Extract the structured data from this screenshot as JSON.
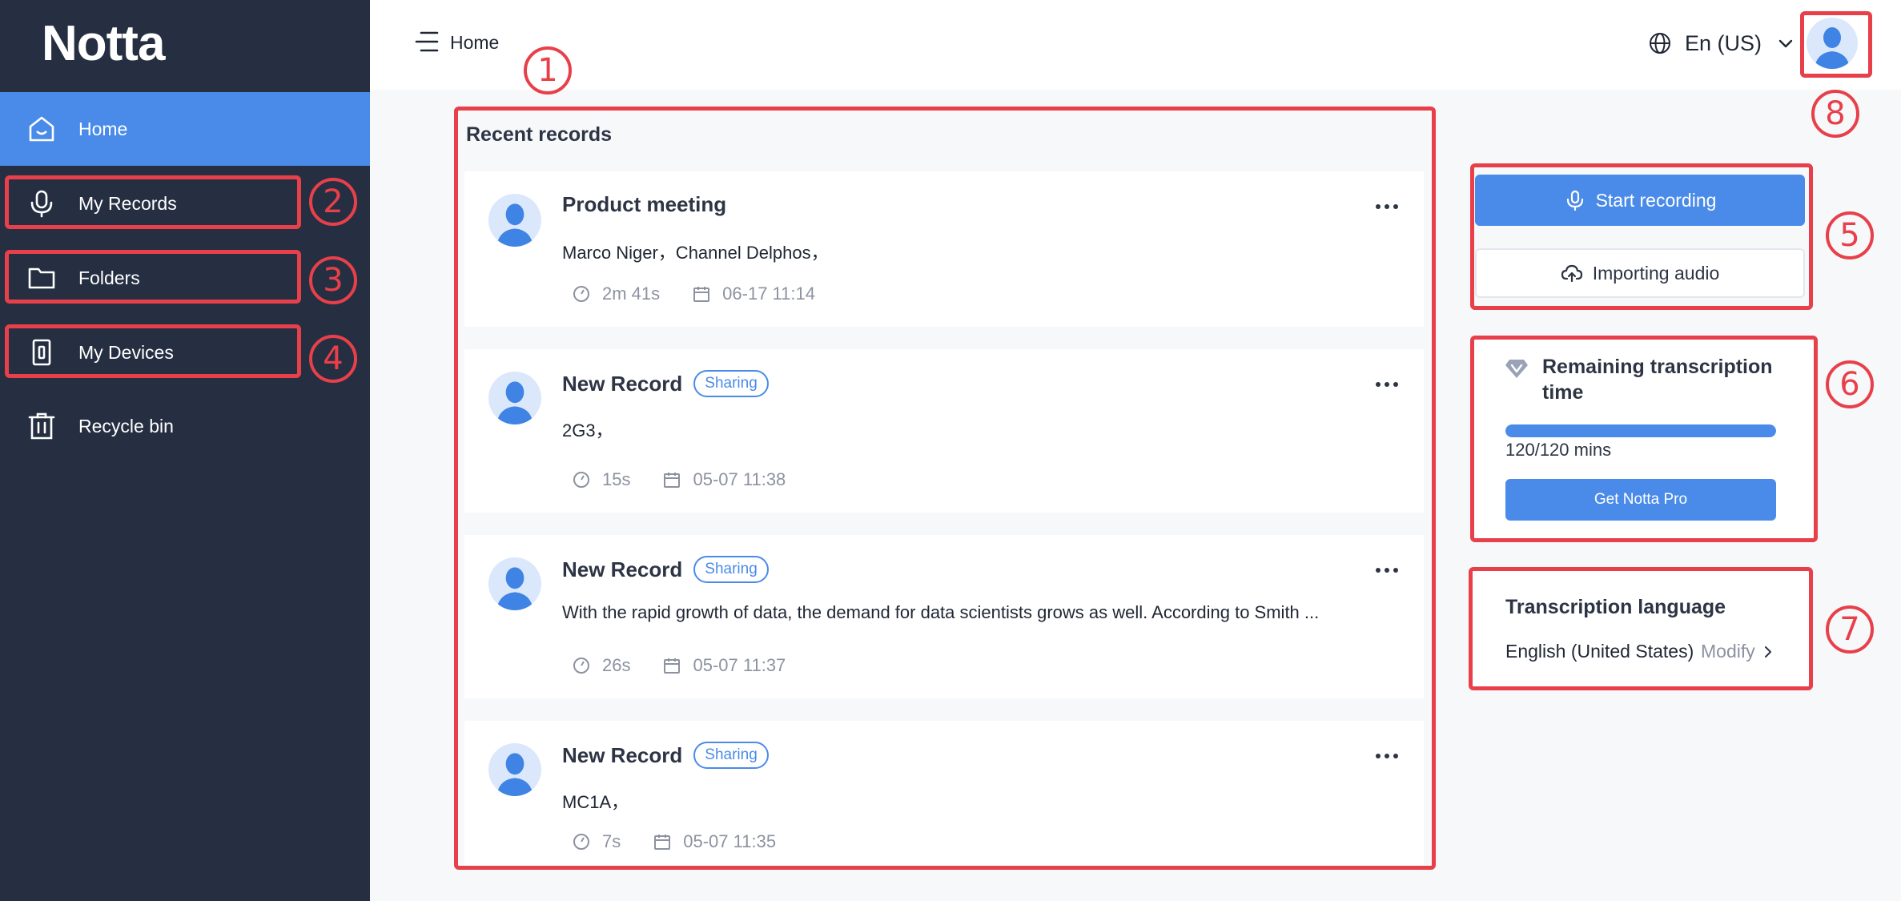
{
  "app": {
    "logo_text": "Notta"
  },
  "sidebar": {
    "items": [
      {
        "label": "Home",
        "icon": "home-icon",
        "active": true
      },
      {
        "label": "My Records",
        "icon": "microphone-icon",
        "active": false
      },
      {
        "label": "Folders",
        "icon": "folder-icon",
        "active": false
      },
      {
        "label": "My Devices",
        "icon": "device-icon",
        "active": false
      },
      {
        "label": "Recycle bin",
        "icon": "trash-icon",
        "active": false
      }
    ]
  },
  "header": {
    "breadcrumb": "Home",
    "language": "En (US)"
  },
  "records": {
    "title": "Recent records",
    "items": [
      {
        "title": "Product meeting",
        "badge": "",
        "desc": "Marco Niger，Channel Delphos，",
        "duration": "2m 41s",
        "date": "06-17 11:14"
      },
      {
        "title": "New Record",
        "badge": "Sharing",
        "desc": "2G3，",
        "duration": "15s",
        "date": "05-07 11:38"
      },
      {
        "title": "New Record",
        "badge": "Sharing",
        "desc": "With the rapid growth of data, the demand for data scientists grows as well. According to Smith ...",
        "duration": "26s",
        "date": "05-07 11:37"
      },
      {
        "title": "New Record",
        "badge": "Sharing",
        "desc": "MC1A，",
        "duration": "7s",
        "date": "05-07 11:35"
      }
    ]
  },
  "actions": {
    "start_recording": "Start recording",
    "import_audio": "Importing audio"
  },
  "quota": {
    "title": "Remaining transcription time",
    "text": "120/120 mins",
    "fraction": 1.0,
    "button": "Get Notta Pro"
  },
  "transcription_language": {
    "title": "Transcription language",
    "value": "English (United States)",
    "modify": "Modify"
  },
  "annotations": [
    "1",
    "2",
    "3",
    "4",
    "5",
    "6",
    "7",
    "8"
  ],
  "colors": {
    "sidebar_bg": "#262f42",
    "accent": "#4a8be9",
    "annotation": "#e8404a"
  }
}
